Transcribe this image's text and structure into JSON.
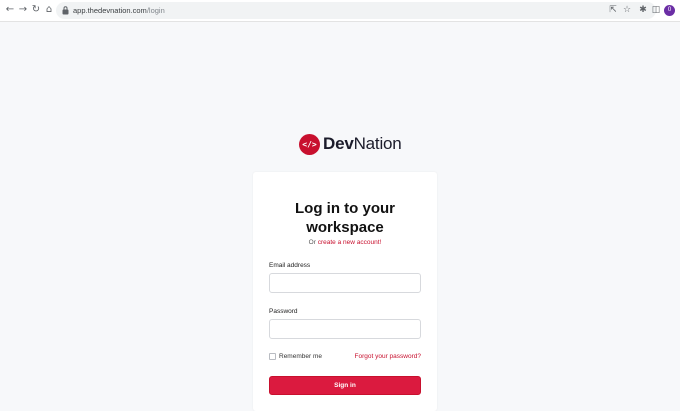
{
  "browser": {
    "url_host": "app.thedevnation.com",
    "url_path": "/login",
    "back_icon": "arrow-left-icon",
    "forward_icon": "arrow-right-icon",
    "reload_icon": "reload-icon",
    "home_icon": "home-icon",
    "profile_initial": "0"
  },
  "brand": {
    "mark": "</>",
    "name_bold": "Dev",
    "name_rest": "Nation",
    "accent": "#c8102e"
  },
  "login": {
    "title_line1": "Log in to your",
    "title_line2": "workspace",
    "subtitle_prefix": "Or",
    "subtitle_link": "create a new account!",
    "email_label": "Email address",
    "email_value": "",
    "password_label": "Password",
    "password_value": "",
    "remember_label": "Remember me",
    "forgot_label": "Forgot your password?",
    "signin_label": "Sign in"
  }
}
